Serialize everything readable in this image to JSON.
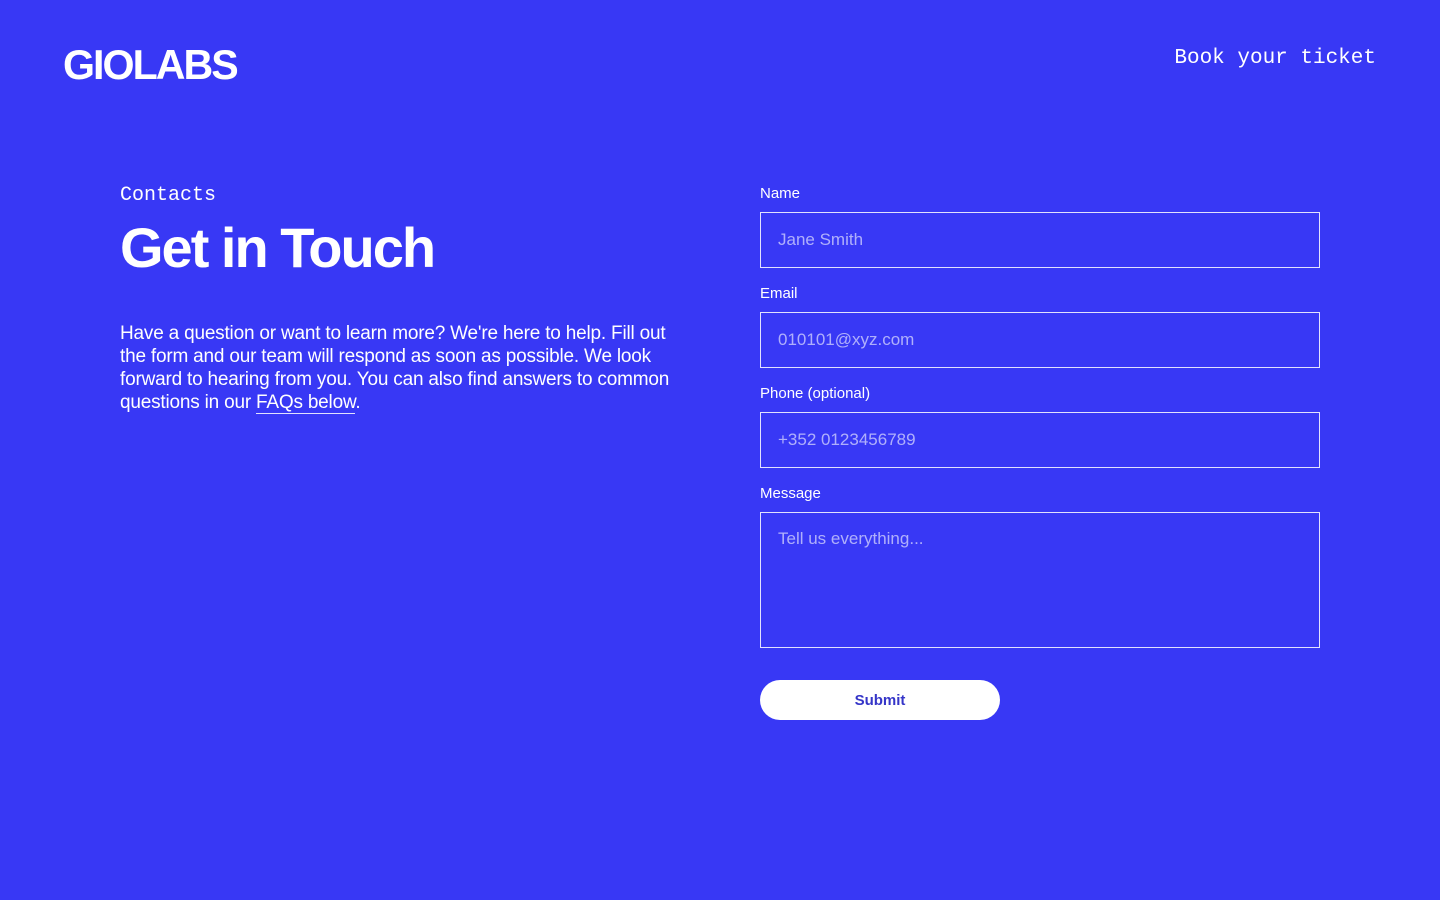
{
  "header": {
    "logo": "GIOLABS",
    "book_link": "Book your ticket"
  },
  "intro": {
    "eyebrow": "Contacts",
    "title": "Get in Touch",
    "body_before_link": "Have a question or want to learn more? We're here to help. Fill out the form and our team will respond as soon as possible. We look forward to hearing from you. You can also find answers to common questions in our ",
    "faq_link": "FAQs below",
    "body_after_link": "."
  },
  "form": {
    "name": {
      "label": "Name",
      "placeholder": "Jane Smith",
      "value": ""
    },
    "email": {
      "label": "Email",
      "placeholder": "010101@xyz.com",
      "value": ""
    },
    "phone": {
      "label": "Phone (optional)",
      "placeholder": "+352 0123456789",
      "value": ""
    },
    "message": {
      "label": "Message",
      "placeholder": "Tell us everything...",
      "value": ""
    },
    "submit_label": "Submit"
  },
  "colors": {
    "background": "#3838f5",
    "text": "#ffffff",
    "button_text": "#3535c8"
  }
}
